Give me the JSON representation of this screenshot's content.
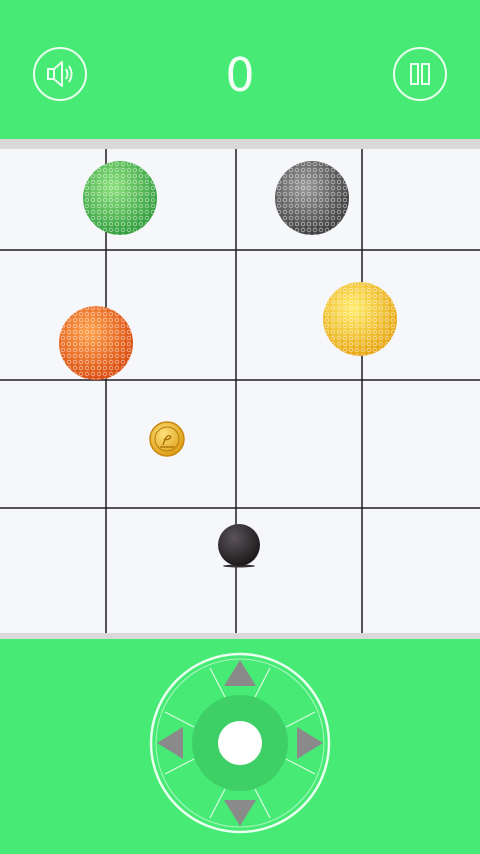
{
  "header": {
    "sound_icon": "speaker-icon",
    "score": "0",
    "pause_icon": "pause-icon"
  },
  "board": {
    "columns": 4,
    "rows": 4,
    "balls": [
      {
        "name": "green-ball",
        "color": "#45b34b"
      },
      {
        "name": "gray-ball",
        "color": "#5b5b5b"
      },
      {
        "name": "orange-ball",
        "color": "#ee6a1a"
      },
      {
        "name": "yellow-ball",
        "color": "#f2c21c"
      }
    ],
    "coin_icon": "coin-icon",
    "player_ball_color": "#2a2628"
  },
  "controls": {
    "up_icon": "arrow-up-icon",
    "down_icon": "arrow-down-icon",
    "left_icon": "arrow-left-icon",
    "right_icon": "arrow-right-icon",
    "center_icon": "center-button-icon"
  },
  "colors": {
    "background": "#46ea74",
    "board": "#f6f7fb",
    "grid": "#1f1f1f"
  }
}
